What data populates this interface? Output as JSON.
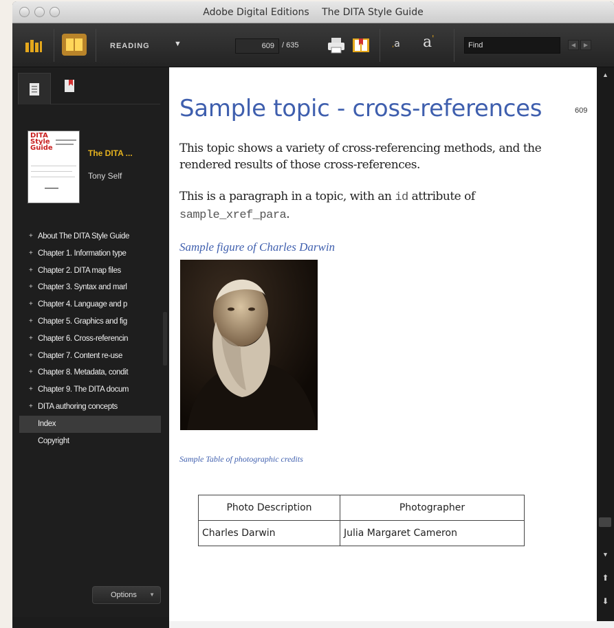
{
  "window": {
    "app_title": "Adobe Digital Editions",
    "doc_title": "The DITA Style Guide"
  },
  "toolbar": {
    "mode_label": "READING",
    "current_page": "609",
    "total_pages": "/ 635",
    "find_placeholder": "Find",
    "font_small_label": "a",
    "font_large_label": "a"
  },
  "sidebar": {
    "book": {
      "title": "The DITA ...",
      "author": "Tony Self",
      "cover_text": [
        "DITA",
        "Style",
        "Guide"
      ]
    },
    "toc": [
      {
        "label": "About The DITA Style Guide",
        "expandable": true
      },
      {
        "label": "Chapter 1. Information type",
        "expandable": true
      },
      {
        "label": "Chapter 2. DITA map files",
        "expandable": true
      },
      {
        "label": "Chapter 3. Syntax and marl",
        "expandable": true
      },
      {
        "label": "Chapter 4. Language and p",
        "expandable": true
      },
      {
        "label": "Chapter 5. Graphics and fig",
        "expandable": true
      },
      {
        "label": "Chapter 6. Cross-referencin",
        "expandable": true
      },
      {
        "label": "Chapter 7. Content re-use",
        "expandable": true
      },
      {
        "label": "Chapter 8. Metadata, condit",
        "expandable": true
      },
      {
        "label": "Chapter 9. The DITA docum",
        "expandable": true
      },
      {
        "label": "DITA authoring concepts",
        "expandable": true
      },
      {
        "label": "Index",
        "expandable": false,
        "selected": true
      },
      {
        "label": "Copyright",
        "expandable": false
      }
    ],
    "options_label": "Options"
  },
  "content": {
    "heading": "Sample topic - cross-references",
    "page_number": "609",
    "para1": "This topic shows a variety of cross-referencing methods, and the rendered results of those cross-references.",
    "para2_prefix": "This is a paragraph in a topic, with an ",
    "para2_code1": "id",
    "para2_mid": " attribute of",
    "para2_code2": "sample_xref_para",
    "para2_suffix": ".",
    "figure_caption": "Sample figure of Charles Darwin",
    "table_caption": "Sample Table of photographic credits",
    "table": {
      "headers": [
        "Photo Description",
        "Photographer"
      ],
      "rows": [
        [
          "Charles Darwin",
          "Julia Margaret Cameron"
        ]
      ]
    }
  },
  "colors": {
    "accent_heading": "#3f5fae",
    "book_title": "#e6b31e",
    "toolbar_icon_gold": "#e5a81c"
  },
  "icons": [
    "library-icon",
    "reading-view-icon",
    "dropdown-icon",
    "print-icon",
    "bookmark-icon",
    "decrease-font-icon",
    "increase-font-icon",
    "prev-result-icon",
    "next-result-icon",
    "toc-icon",
    "bookmarks-tab-icon",
    "scroll-up-icon",
    "scroll-down-icon",
    "plus-icon"
  ]
}
